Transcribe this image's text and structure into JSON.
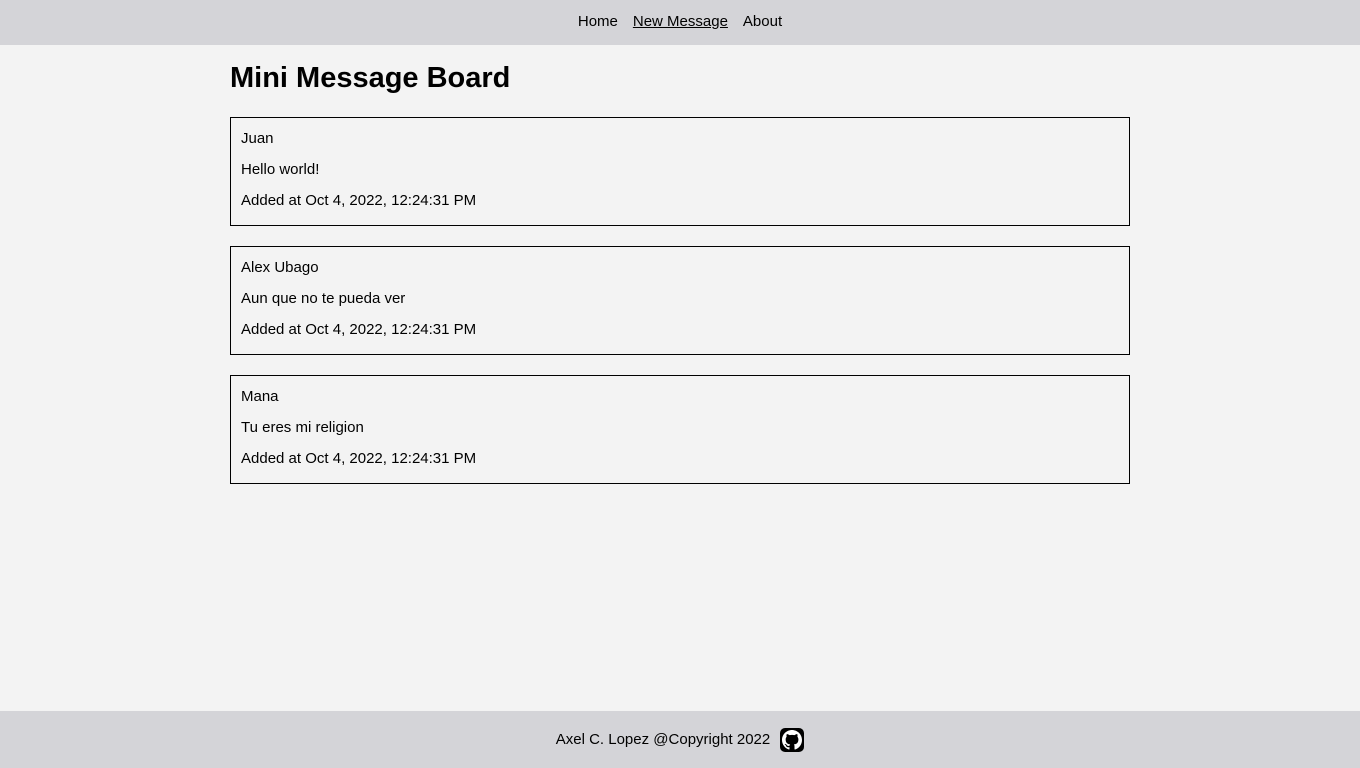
{
  "nav": {
    "items": [
      {
        "label": "Home"
      },
      {
        "label": "New Message"
      },
      {
        "label": "About"
      }
    ]
  },
  "page": {
    "title": "Mini Message Board"
  },
  "messages": [
    {
      "user": "Juan",
      "text": "Hello world!",
      "added": "Added at Oct 4, 2022, 12:24:31 PM"
    },
    {
      "user": "Alex Ubago",
      "text": "Aun que no te pueda ver",
      "added": "Added at Oct 4, 2022, 12:24:31 PM"
    },
    {
      "user": "Mana",
      "text": "Tu eres mi religion",
      "added": "Added at Oct 4, 2022, 12:24:31 PM"
    }
  ],
  "footer": {
    "text": "Axel C. Lopez @Copyright 2022",
    "icon": "github-icon"
  }
}
